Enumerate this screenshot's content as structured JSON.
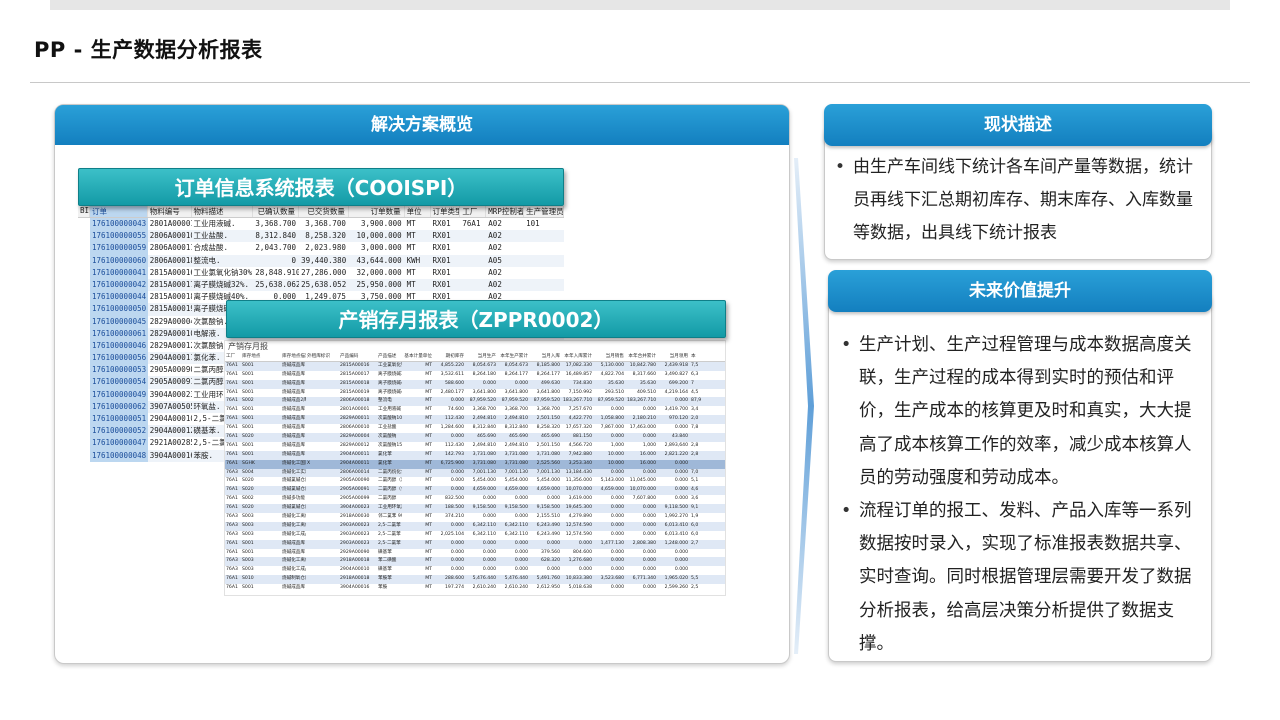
{
  "page": {
    "title": "PP - 生产数据分析报表"
  },
  "left_panel": {
    "header": "解决方案概览",
    "banner1": "订单信息系统报表（COOISPI）",
    "banner2": "产销存月报表（ZPPR0002）",
    "cooispi": {
      "headers": [
        "BI",
        "订单",
        "物料编号",
        "物料描述",
        "已确认数量",
        "已交货数量",
        "订单数量",
        "单位",
        "订单类型",
        "工厂",
        "MRP控制者",
        "生产管理员"
      ],
      "rows": [
        [
          "176100000043",
          "2801A00001",
          "工业用液碱.",
          "3,368.700",
          "3,368.700",
          "3,900.000",
          "MT",
          "RX01",
          "76A1",
          "A02",
          "101"
        ],
        [
          "176100000055",
          "2806A00010",
          "工业盐酸.",
          "8,312.840",
          "8,258.320",
          "10,000.000",
          "MT",
          "RX01",
          "",
          "A02",
          ""
        ],
        [
          "176100000059",
          "2806A00011",
          "合成盐酸.",
          "2,043.700",
          "2,023.980",
          "3,000.000",
          "MT",
          "RX01",
          "",
          "A02",
          ""
        ],
        [
          "176100000060",
          "2806A00018",
          "整流电.",
          "0",
          "39,440.380",
          "43,644.000",
          "KWH",
          "RX01",
          "",
          "A05",
          ""
        ],
        [
          "176100000041",
          "2815A00016",
          "工业氯氧化钠30%.",
          "28,848.910",
          "27,286.000",
          "32,000.000",
          "MT",
          "RX01",
          "",
          "A02",
          ""
        ],
        [
          "176100000042",
          "2815A00017",
          "离子膜烧碱32%.",
          "25,638.062",
          "25,638.052",
          "25,950.000",
          "MT",
          "RX01",
          "",
          "A02",
          ""
        ],
        [
          "176100000044",
          "2815A00018",
          "离子膜烧碱40%.",
          "0.000",
          "1,249.075",
          "3,750.000",
          "MT",
          "RX01",
          "",
          "A02",
          ""
        ],
        [
          "176100000050",
          "2815A00019",
          "离子膜烧碱49%.",
          "7,420.612",
          "7,420.612",
          "6,000.000",
          "MT",
          "RX01",
          "",
          "A02",
          ""
        ],
        [
          "176100000045",
          "2829A00004",
          "次氯酸钠.",
          "",
          "",
          "",
          "",
          "",
          "",
          "",
          ""
        ],
        [
          "176100000061",
          "2829A00010",
          "电解液.",
          "",
          "",
          "",
          "",
          "",
          "",
          "",
          ""
        ],
        [
          "176100000046",
          "2829A00012",
          "次氯酸钠.",
          "",
          "",
          "",
          "",
          "",
          "",
          "",
          ""
        ],
        [
          "176100000056",
          "2904A00011",
          "氯化苯.",
          "",
          "",
          "",
          "",
          "",
          "",
          "",
          ""
        ],
        [
          "176100000053",
          "2905A00090",
          "二氯丙醇.",
          "",
          "",
          "",
          "",
          "",
          "",
          "",
          ""
        ],
        [
          "176100000054",
          "2905A00091",
          "二氯丙醇.",
          "",
          "",
          "",
          "",
          "",
          "",
          "",
          ""
        ],
        [
          "176100000049",
          "3904A00023",
          "工业用环.",
          "",
          "",
          "",
          "",
          "",
          "",
          "",
          ""
        ],
        [
          "176100000062",
          "3907A00505",
          "环氧盐.",
          "",
          "",
          "",
          "",
          "",
          "",
          "",
          ""
        ],
        [
          "176100000051",
          "2904A00010",
          "2,5-二氯.",
          "",
          "",
          "",
          "",
          "",
          "",
          "",
          ""
        ],
        [
          "176100000052",
          "2904A00012",
          "磺基苯.",
          "",
          "",
          "",
          "",
          "",
          "",
          "",
          ""
        ],
        [
          "176100000047",
          "2921A00285",
          "2,5-二氯.",
          "",
          "",
          "",
          "",
          "",
          "",
          "",
          ""
        ],
        [
          "176100000048",
          "3904A00016",
          "苯胺.",
          "",
          "",
          "",
          "",
          "",
          "",
          "",
          ""
        ],
        [
          "176100000057",
          "2806A00013",
          "低压蒸汽.",
          "",
          "",
          "",
          "",
          "",
          "",
          "",
          ""
        ],
        [
          "176100000058",
          "2806A00019",
          "动力电.",
          "",
          "",
          "",
          "",
          "",
          "",
          "",
          ""
        ]
      ]
    },
    "zppr": {
      "title": "产销存月报",
      "headers": [
        "工厂",
        "库存地点",
        "库存地点描述",
        "外租库标识",
        "产品编码",
        "产品描述",
        "基本计量单位",
        "期初库存",
        "当月生产",
        "本年生产累计",
        "当月入库",
        "本年入库累计",
        "当月销售",
        "本年合并累计",
        "当月领用",
        "本"
      ],
      "rows": [
        [
          "76A1",
          "S001",
          "烧碱成品库",
          "",
          "2815A00016",
          "工业氯氧化钠30%",
          "MT",
          "4,855.220",
          "8,054.673",
          "8,054.673",
          "8,185.800",
          "17,082.330",
          "5,130.000",
          "10,842.780",
          "2,439.918",
          "7,5"
        ],
        [
          "76A1",
          "S001",
          "烧碱成品库",
          "",
          "2815A00017",
          "离子膜烧碱32%",
          "MT",
          "3,532.611",
          "8,264.180",
          "8,264.177",
          "8,264.177",
          "16,489.857",
          "4,822.704",
          "8,317.660",
          "3,490.827",
          "6,3"
        ],
        [
          "76A1",
          "S001",
          "烧碱成品库",
          "",
          "2815A00018",
          "离子膜烧碱40%",
          "MT",
          "588.600",
          "0.000",
          "0.000",
          "499.630",
          "734.830",
          "35.630",
          "35.630",
          "699.200",
          "7"
        ],
        [
          "76A1",
          "S001",
          "烧碱成品库",
          "",
          "2815A00019",
          "离子膜烧碱49%",
          "MT",
          "2,480.177",
          "3,641.800",
          "3,641.800",
          "3,641.800",
          "7,150.992",
          "293.510",
          "409.510",
          "4,219.164",
          "4,5"
        ],
        [
          "76A1",
          "S002",
          "烧碱成品2库",
          "",
          "2806A00018",
          "整流电",
          "MT",
          "0.000",
          "87,959.520",
          "87,959.520",
          "87,959.520",
          "183,267.710",
          "87,959.520",
          "183,267.710",
          "0.000",
          "87,9"
        ],
        [
          "76A1",
          "S001",
          "烧碱成品库",
          "",
          "2801A00001",
          "工业用液碱",
          "MT",
          "74.600",
          "3,368.700",
          "3,368.700",
          "3,368.700",
          "7,257.670",
          "0.000",
          "0.000",
          "3,419.700",
          "3,4"
        ],
        [
          "76A1",
          "S001",
          "烧碱成品库",
          "",
          "2829A00011",
          "次氯酸钠10%",
          "MT",
          "112.430",
          "2,494.810",
          "2,494.810",
          "2,501.150",
          "4,422.770",
          "1,058.800",
          "2,180.210",
          "970.120",
          "2,0"
        ],
        [
          "76A1",
          "S001",
          "烧碱成品库",
          "",
          "2806A00010",
          "工业盐酸",
          "MT",
          "1,284.600",
          "8,312.840",
          "8,312.840",
          "8,258.320",
          "17,657.320",
          "7,867.000",
          "17,463.000",
          "0.000",
          "7,8"
        ],
        [
          "76A1",
          "S020",
          "烧碱成品库",
          "",
          "2829A00004",
          "次氯酸钠",
          "MT",
          "0.000",
          "465.690",
          "465.690",
          "465.690",
          "881.150",
          "0.000",
          "0.000",
          "43.840",
          ""
        ],
        [
          "76A1",
          "S001",
          "烧碱成品库",
          "",
          "2829A00012",
          "次氯酸钠15%",
          "MT",
          "112.430",
          "2,494.810",
          "2,494.810",
          "2,501.150",
          "4,566.720",
          "1,000",
          "1,000",
          "2,893,640",
          "2,8"
        ],
        [
          "76A1",
          "S001",
          "烧碱成品库",
          "",
          "2904A00011",
          "氯化苯",
          "MT",
          "142.793",
          "3,731.080",
          "3,731.080",
          "3,731.080",
          "7,942.880",
          "10.000",
          "16.000",
          "2,821.220",
          "2,8"
        ],
        [
          "76A1",
          "SGHK",
          "烧碱化工国际库",
          "X",
          "2904A00011",
          "氯化苯",
          "MT",
          "6,725.900",
          "3,731.080",
          "3,731.080",
          "2,525.560",
          "3,253.340",
          "10.000",
          "16.000",
          "0.000",
          ""
        ],
        [
          "76A3",
          "S004",
          "烧碱化工实验库",
          "",
          "2806A00014",
          "二氯丙烷化合物",
          "MT",
          "0.000",
          "7,001.130",
          "7,001.130",
          "7,001.130",
          "13,184.430",
          "0.000",
          "0.000",
          "0.000",
          "7,0"
        ],
        [
          "76A1",
          "S020",
          "烧碱氯碱仓库",
          "",
          "2905A00090",
          "二氯丙醇（液）",
          "MT",
          "0.000",
          "5,454.000",
          "5,454.000",
          "5,454.000",
          "11,356.000",
          "5,143.000",
          "11,045.000",
          "0.000",
          "5,1"
        ],
        [
          "76A1",
          "S020",
          "烧碱氯碱仓库",
          "",
          "2905A00091",
          "二氯丙醇（化）",
          "MT",
          "0.000",
          "4,659.000",
          "4,659.000",
          "4,659.000",
          "10,070.000",
          "4,659.000",
          "10,070.000",
          "0.000",
          "4,6"
        ],
        [
          "76A1",
          "S002",
          "烧碱多功能",
          "",
          "2905A00099",
          "二氯丙醇",
          "MT",
          "832.500",
          "0.000",
          "0.000",
          "0.000",
          "3,619.000",
          "0.000",
          "7,607.800",
          "0.000",
          "3,6"
        ],
        [
          "76A1",
          "S020",
          "烧碱氯碱仓库",
          "",
          "3904A00023",
          "工业用环氧氯丙烷",
          "MT",
          "188.500",
          "9,158.500",
          "9,158.500",
          "9,158.500",
          "19,645.300",
          "0.000",
          "0.000",
          "9,118.500",
          "9,1"
        ],
        [
          "76A3",
          "S003",
          "烧碱化工离线库",
          "",
          "2918A00030",
          "邻二氯苯 99.8%",
          "MT",
          "374.210",
          "0.000",
          "0.000",
          "2,155.510",
          "4,279.890",
          "0.000",
          "0.000",
          "1,992.270",
          "1,9"
        ],
        [
          "76A3",
          "S003",
          "烧碱化工离线库",
          "",
          "2903A00023",
          "2,5-二氯苯（液）",
          "MT",
          "0.000",
          "6,342.110",
          "6,342.110",
          "6,243.490",
          "12,574.590",
          "0.000",
          "0.000",
          "6,013.410",
          "6,0"
        ],
        [
          "76A3",
          "S003",
          "烧碱化工成品库",
          "",
          "2903A00023",
          "2,5-二氯苯（液）",
          "MT",
          "2,025.104",
          "6,342.110",
          "6,342.110",
          "6,243.490",
          "12,574.590",
          "0.000",
          "0.000",
          "6,013.410",
          "6,0"
        ],
        [
          "76A1",
          "S001",
          "烧碱成品库",
          "",
          "2903A00023",
          "2,5-二氯苯（液）",
          "MT",
          "0.000",
          "0.000",
          "0.000",
          "0.000",
          "0.000",
          "1,477.130",
          "2,808.380",
          "1,248.000",
          "2,7"
        ],
        [
          "76A1",
          "S001",
          "烧碱成品库",
          "",
          "2929A00090",
          "磺基苯",
          "MT",
          "0.000",
          "0.000",
          "0.000",
          "379.560",
          "804.600",
          "0.000",
          "0.000",
          "0.000",
          ""
        ],
        [
          "76A3",
          "S003",
          "烧碱化工离线库",
          "",
          "2918A00018",
          "苯二磺酸",
          "MT",
          "0.000",
          "0.000",
          "0.000",
          "628.320",
          "1,276.680",
          "0.000",
          "0.000",
          "0.000",
          ""
        ],
        [
          "76A3",
          "S003",
          "烧碱化工成品库",
          "",
          "2904A00010",
          "磺基苯",
          "MT",
          "0.000",
          "0.000",
          "0.000",
          "0.000",
          "0.000",
          "0.000",
          "0.000",
          "0.000",
          ""
        ],
        [
          "76A1",
          "S010",
          "烧碱制氧仓库",
          "",
          "2918A00018",
          "苯胺苯",
          "MT",
          "288.600",
          "5,476.440",
          "5,476.440",
          "5,491.760",
          "10,833.380",
          "3,523.680",
          "6,771.340",
          "1,965.020",
          "5,5"
        ],
        [
          "76A1",
          "S001",
          "烧碱成品库",
          "",
          "3904A00016",
          "苯胺",
          "MT",
          "197.274",
          "2,610.240",
          "2,610.240",
          "2,612.950",
          "5,018.638",
          "0.000",
          "0.000",
          "2,599.260",
          "2,5"
        ]
      ]
    }
  },
  "status_panel": {
    "header": "现状描述",
    "bullets": [
      "由生产车间线下统计各车间产量等数据，统计员再线下汇总期初库存、期末库存、入库数量等数据，出具线下统计报表"
    ]
  },
  "value_panel": {
    "header": "未来价值提升",
    "bullets": [
      "生产计划、生产过程管理与成本数据高度关联，生产过程的成本得到实时的预估和评价，生产成本的核算更及时和真实，大大提高了成本核算工作的效率，减少成本核算人员的劳动强度和劳动成本。",
      "流程订单的报工、发料、产品入库等一系列数据按时录入，实现了标准报表数据共享、实时查询。同时根据管理层需要开发了数据分析报表，给高层决策分析提供了数据支撑。"
    ]
  },
  "colors": {
    "header_blue": "#1a8fcf",
    "banner_teal": "#22aab4",
    "selection_blue": "#bcd7f0"
  }
}
